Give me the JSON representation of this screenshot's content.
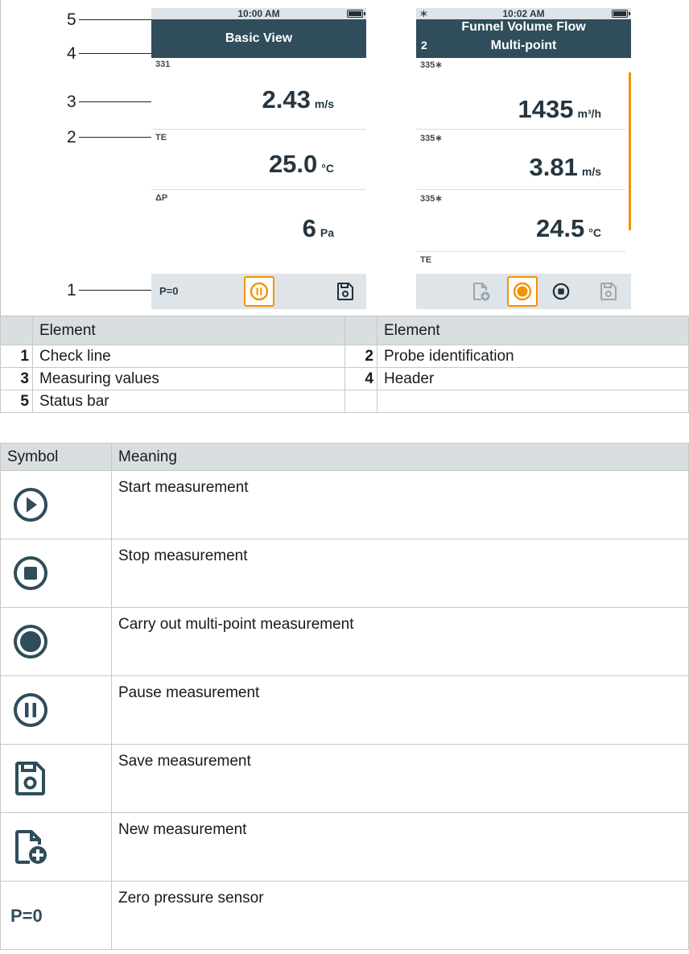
{
  "callouts": [
    "5",
    "4",
    "3",
    "2",
    "1"
  ],
  "screen_left": {
    "time": "10:00 AM",
    "title": "Basic View",
    "probes": [
      {
        "id": "331",
        "value": "2.43",
        "unit": "m/s"
      },
      {
        "id": "TE",
        "value": "25.0",
        "unit": "°C"
      },
      {
        "id": "ΔP",
        "value": "6",
        "unit": "Pa"
      }
    ],
    "check_line": {
      "pzero": "P=0",
      "center_icon": "pause-icon",
      "right_icon": "save-icon"
    }
  },
  "screen_right": {
    "time": "10:02 AM",
    "title": "Funnel Volume Flow",
    "subtitle": "Multi-point",
    "point_number": "2",
    "probes": [
      {
        "id": "335∗",
        "value": "1435",
        "unit": "m³/h"
      },
      {
        "id": "335∗",
        "value": "3.81",
        "unit": "m/s"
      },
      {
        "id": "335∗",
        "value": "24.5",
        "unit": "°C"
      },
      {
        "id": "TE",
        "value": "",
        "unit": ""
      }
    ],
    "check_line": {
      "icons": [
        "new-measurement-icon",
        "multipoint-icon",
        "stop-icon",
        "save-icon"
      ]
    },
    "accent_color": "#f39200"
  },
  "elements_table": {
    "headers": [
      "Element",
      "Element"
    ],
    "rows": [
      [
        {
          "num": "1",
          "text": "Check line"
        },
        {
          "num": "2",
          "text": "Probe identification"
        }
      ],
      [
        {
          "num": "3",
          "text": "Measuring values"
        },
        {
          "num": "4",
          "text": "Header"
        }
      ],
      [
        {
          "num": "5",
          "text": "Status bar"
        },
        {
          "num": "",
          "text": ""
        }
      ]
    ]
  },
  "symbols_table": {
    "headers": [
      "Symbol",
      "Meaning"
    ],
    "rows": [
      {
        "icon": "play-icon",
        "meaning": "Start measurement"
      },
      {
        "icon": "stop-icon",
        "meaning": "Stop measurement"
      },
      {
        "icon": "multipoint-icon",
        "meaning": "Carry out multi-point measurement"
      },
      {
        "icon": "pause-icon",
        "meaning": "Pause measurement"
      },
      {
        "icon": "save-icon",
        "meaning": "Save measurement"
      },
      {
        "icon": "new-measurement-icon",
        "meaning": "New measurement"
      },
      {
        "icon": "p-zero-text",
        "meaning": "Zero pressure sensor",
        "symbol_text": "P=0"
      }
    ]
  },
  "colors": {
    "header": "#2f4d5a",
    "status": "#dfe4e8",
    "accent": "#f39200",
    "table_head": "#d9dee1"
  }
}
